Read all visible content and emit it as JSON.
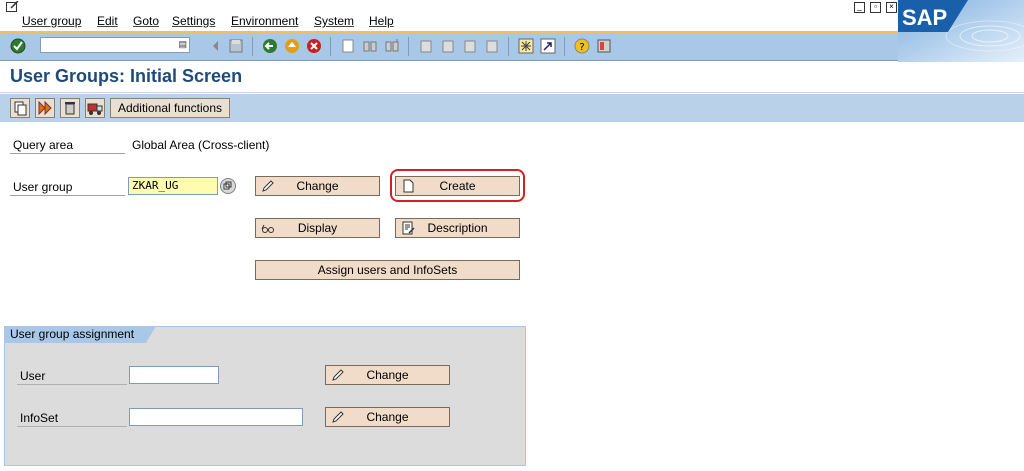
{
  "menu": {
    "items": [
      "User group",
      "Edit",
      "Goto",
      "Settings",
      "Environment",
      "System",
      "Help"
    ]
  },
  "window_controls": {
    "minimize": "_",
    "restore": "▫",
    "close": "×"
  },
  "logo": {
    "text": "SAP"
  },
  "toolbar": {
    "command_field_value": "",
    "icons": [
      "enter-icon",
      "back-icon",
      "exit-icon",
      "cancel-icon",
      "print-icon",
      "find-icon",
      "find-next-icon",
      "first-page-icon",
      "previous-page-icon",
      "next-page-icon",
      "last-page-icon",
      "create-session-icon",
      "shortcut-icon",
      "help-icon",
      "layout-icon"
    ]
  },
  "page": {
    "title": "User Groups: Initial Screen"
  },
  "app_toolbar": {
    "additional_functions_label": "Additional functions"
  },
  "form": {
    "query_area_label": "Query area",
    "query_area_value": "Global Area (Cross-client)",
    "user_group_label": "User group",
    "user_group_value": "ZKAR_UG",
    "change_label": "Change",
    "create_label": "Create",
    "display_label": "Display",
    "description_label": "Description",
    "assign_label": "Assign users and InfoSets"
  },
  "assignment": {
    "title": "User group assignment",
    "user_label": "User",
    "user_value": "",
    "infoset_label": "InfoSet",
    "infoset_value": "",
    "change_user_label": "Change",
    "change_infoset_label": "Change"
  },
  "colors": {
    "title": "#1f4b7a",
    "toolbar": "#a9c8e8",
    "highlight": "#d42020",
    "input_required": "#fffcb0"
  }
}
